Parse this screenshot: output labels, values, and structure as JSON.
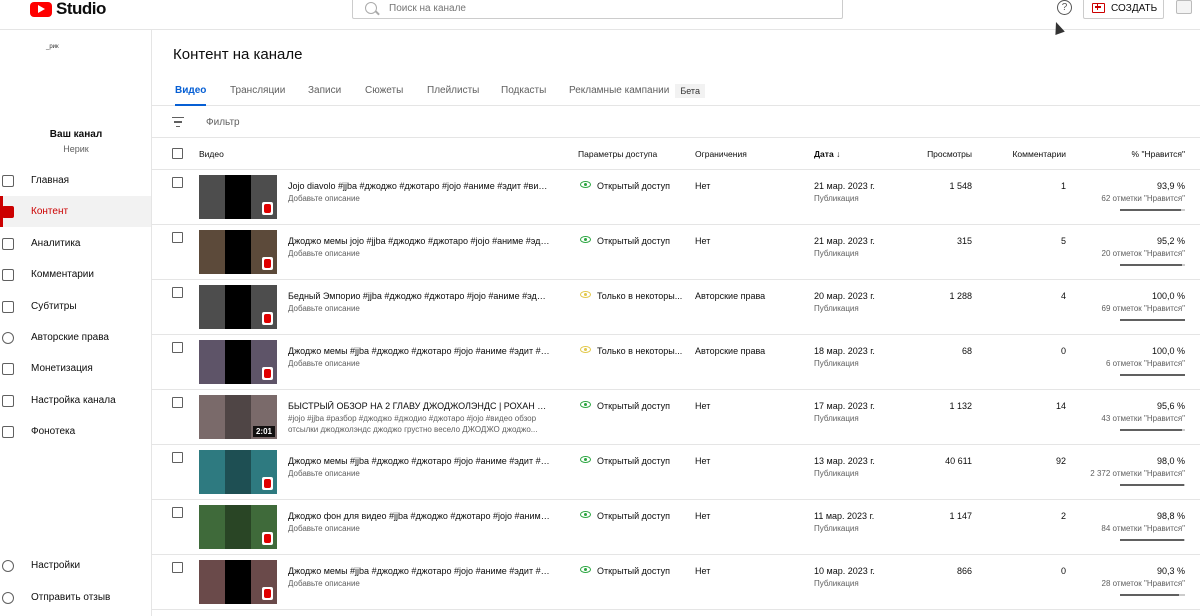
{
  "header": {
    "logo_text": "Studio",
    "search_placeholder": "Поиск на канале",
    "create_label": "СОЗДАТЬ"
  },
  "sidebar": {
    "channel_avatar_text": "_рик",
    "channel_title": "Ваш канал",
    "channel_name": "Нерик",
    "items": [
      {
        "label": "Главная",
        "icon": "dashboard-icon"
      },
      {
        "label": "Контент",
        "icon": "content-icon",
        "active": true
      },
      {
        "label": "Аналитика",
        "icon": "analytics-icon"
      },
      {
        "label": "Комментарии",
        "icon": "comments-icon"
      },
      {
        "label": "Субтитры",
        "icon": "subtitles-icon"
      },
      {
        "label": "Авторские права",
        "icon": "copyright-icon"
      },
      {
        "label": "Монетизация",
        "icon": "monetization-icon"
      },
      {
        "label": "Настройка канала",
        "icon": "customization-icon"
      },
      {
        "label": "Фонотека",
        "icon": "audio-library-icon"
      }
    ],
    "bottom": [
      {
        "label": "Настройки",
        "icon": "settings-icon"
      },
      {
        "label": "Отправить отзыв",
        "icon": "feedback-icon"
      }
    ]
  },
  "main": {
    "title": "Контент на канале",
    "tabs": [
      {
        "label": "Видео",
        "active": true
      },
      {
        "label": "Трансляции"
      },
      {
        "label": "Записи"
      },
      {
        "label": "Сюжеты"
      },
      {
        "label": "Плейлисты"
      },
      {
        "label": "Подкасты"
      },
      {
        "label": "Рекламные кампании"
      }
    ],
    "beta_label": "Бета",
    "filter_label": "Фильтр",
    "columns": {
      "video": "Видео",
      "visibility": "Параметры доступа",
      "restrictions": "Ограничения",
      "date": "Дата",
      "views": "Просмотры",
      "comments": "Комментарии",
      "likes": "% \"Нравится\""
    }
  },
  "rows": [
    {
      "title": "Jojo diavolo #jjba #джоджо #джотаро #jojo #аниме #эдит #виде...",
      "desc": "Добавьте описание",
      "desc2": "",
      "visibility": "Открытый доступ",
      "vis_color": "green",
      "restrictions": "Нет",
      "date": "21 мар. 2023 г.",
      "date_sub": "Публикация",
      "views": "1 548",
      "comments": "1",
      "likes_pct": "93,9 %",
      "likes_count": "62 отметки \"Нравится\"",
      "likes_ratio": 0.939,
      "duration": "",
      "thumb": "#4d4d4d"
    },
    {
      "title": "Джоджо мемы jojo #jjba #джоджо #джотаро #jojo #аниме #эдит...",
      "desc": "Добавьте описание",
      "desc2": "",
      "visibility": "Открытый доступ",
      "vis_color": "green",
      "restrictions": "Нет",
      "date": "21 мар. 2023 г.",
      "date_sub": "Публикация",
      "views": "315",
      "comments": "5",
      "likes_pct": "95,2 %",
      "likes_count": "20 отметок \"Нравится\"",
      "likes_ratio": 0.952,
      "duration": "",
      "thumb": "#5c4a3a"
    },
    {
      "title": "Бедный Эмпорио #jjba #джоджо #джотаро #jojo #аниме #эдит ...",
      "desc": "Добавьте описание",
      "desc2": "",
      "visibility": "Только в некоторы...",
      "vis_color": "yellow",
      "restrictions": "Авторские права",
      "date": "20 мар. 2023 г.",
      "date_sub": "Публикация",
      "views": "1 288",
      "comments": "4",
      "likes_pct": "100,0 %",
      "likes_count": "69 отметок \"Нравится\"",
      "likes_ratio": 1.0,
      "duration": "",
      "thumb": "#4d4d4d"
    },
    {
      "title": "Джоджо мемы #jjba #джоджо #джотаро #jojo #аниме #эдит #в...",
      "desc": "Добавьте описание",
      "desc2": "",
      "visibility": "Только в некоторы...",
      "vis_color": "yellow",
      "restrictions": "Авторские права",
      "date": "18 мар. 2023 г.",
      "date_sub": "Публикация",
      "views": "68",
      "comments": "0",
      "likes_pct": "100,0 %",
      "likes_count": "6 отметок \"Нравится\"",
      "likes_ratio": 1.0,
      "duration": "",
      "thumb": "#5e5468"
    },
    {
      "title": "БЫСТРЫЙ ОБЗОР НА 2 ГЛАВУ ДЖОДЖОЛЭНДС | РОХАН В 9 ЧА...",
      "desc": "#jojo #jjba #разбор #джоджо #джодио #джотаро #jojo #видео обзор",
      "desc2": "отсылки джоджолэндс джоджо грустно весело ДЖОДЖО джоджо...",
      "visibility": "Открытый доступ",
      "vis_color": "green",
      "restrictions": "Нет",
      "date": "17 мар. 2023 г.",
      "date_sub": "Публикация",
      "views": "1 132",
      "comments": "14",
      "likes_pct": "95,6 %",
      "likes_count": "43 отметки \"Нравится\"",
      "likes_ratio": 0.956,
      "duration": "2:01",
      "thumb": "#7a6a6a"
    },
    {
      "title": "Джоджо мемы #jjba #джоджо #джотаро #jojo #аниме #эдит #в...",
      "desc": "Добавьте описание",
      "desc2": "",
      "visibility": "Открытый доступ",
      "vis_color": "green",
      "restrictions": "Нет",
      "date": "13 мар. 2023 г.",
      "date_sub": "Публикация",
      "views": "40 611",
      "comments": "92",
      "likes_pct": "98,0 %",
      "likes_count": "2 372 отметки \"Нравится\"",
      "likes_ratio": 0.98,
      "duration": "",
      "thumb": "#2e7a80"
    },
    {
      "title": "Джоджо фон для видео #jjba #джоджо #джотаро #jojo #аниме ...",
      "desc": "Добавьте описание",
      "desc2": "",
      "visibility": "Открытый доступ",
      "vis_color": "green",
      "restrictions": "Нет",
      "date": "11 мар. 2023 г.",
      "date_sub": "Публикация",
      "views": "1 147",
      "comments": "2",
      "likes_pct": "98,8 %",
      "likes_count": "84 отметки \"Нравится\"",
      "likes_ratio": 0.988,
      "duration": "",
      "thumb": "#3f6a3a"
    },
    {
      "title": "Джоджо мемы #jjba #джоджо #джотаро #jojo #аниме #эдит #в...",
      "desc": "Добавьте описание",
      "desc2": "",
      "visibility": "Открытый доступ",
      "vis_color": "green",
      "restrictions": "Нет",
      "date": "10 мар. 2023 г.",
      "date_sub": "Публикация",
      "views": "866",
      "comments": "0",
      "likes_pct": "90,3 %",
      "likes_count": "28 отметок \"Нравится\"",
      "likes_ratio": 0.903,
      "duration": "",
      "thumb": "#6a4a4a"
    }
  ]
}
